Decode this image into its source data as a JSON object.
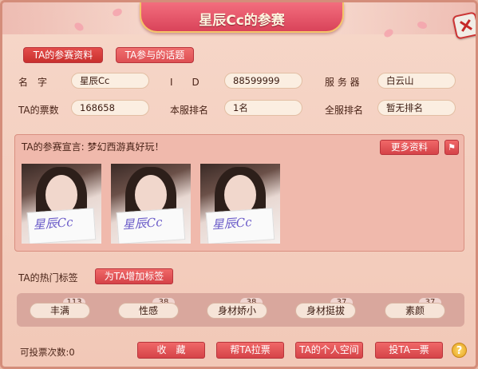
{
  "window": {
    "title": "星辰Cc的参赛"
  },
  "tabs": [
    {
      "label": "TA的参赛资料",
      "active": true
    },
    {
      "label": "TA参与的话题",
      "active": false
    }
  ],
  "profile": {
    "name_label": "名　字",
    "name_value": "星辰Cc",
    "id_label": "I　　D",
    "id_value": "88599999",
    "server_label": "服 务 器",
    "server_value": "白云山",
    "votes_label": "TA的票数",
    "votes_value": "168658",
    "local_rank_label": "本服排名",
    "local_rank_value": "1名",
    "global_rank_label": "全服排名",
    "global_rank_value": "暂无排名"
  },
  "declaration": {
    "text": "TA的参赛宣言: 梦幻西游真好玩！",
    "more_label": "更多资料",
    "flag_icon": "report-icon",
    "photos": [
      {
        "sign_text": "星辰Cc"
      },
      {
        "sign_text": "星辰Cc"
      },
      {
        "sign_text": "星辰Cc"
      }
    ]
  },
  "tags": {
    "label": "TA的热门标签",
    "add_label": "为TA增加标签",
    "items": [
      {
        "label": "丰满",
        "count": "113"
      },
      {
        "label": "性感",
        "count": "38"
      },
      {
        "label": "身材娇小",
        "count": "38"
      },
      {
        "label": "身材挺拔",
        "count": "37"
      },
      {
        "label": "素颜",
        "count": "37"
      }
    ]
  },
  "footer": {
    "votes_left": "可投票次数:0",
    "collect_label": "收　藏",
    "pull_votes_label": "帮TA拉票",
    "space_label": "TA的个人空间",
    "vote_label": "投TA一票",
    "help_icon": "question-icon"
  },
  "colors": {
    "accent": "#d9435a",
    "button": "#d54348",
    "panel": "#f0b9ac"
  }
}
